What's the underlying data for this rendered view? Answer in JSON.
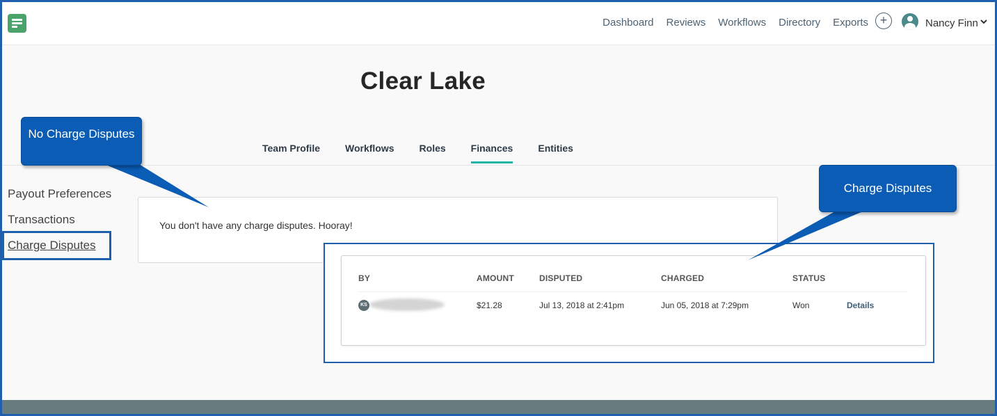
{
  "nav": {
    "links": [
      "Dashboard",
      "Reviews",
      "Workflows",
      "Directory",
      "Exports"
    ],
    "plus_symbol": "+",
    "user_name": "Nancy Finn"
  },
  "page": {
    "title": "Clear Lake",
    "tabs": [
      "Team Profile",
      "Workflows",
      "Roles",
      "Finances",
      "Entities"
    ],
    "active_tab": "Finances"
  },
  "sidebar": {
    "items": [
      "Payout Preferences",
      "Transactions",
      "Charge Disputes"
    ]
  },
  "empty_state": {
    "message": "You don't have any charge disputes. Hooray!"
  },
  "disputes": {
    "headers": [
      "BY",
      "AMOUNT",
      "DISPUTED",
      "CHARGED",
      "STATUS"
    ],
    "rows": [
      {
        "initials": "KS",
        "amount": "$21.28",
        "disputed": "Jul 13, 2018 at 2:41pm",
        "charged": "Jun 05, 2018 at 7:29pm",
        "status": "Won",
        "action": "Details"
      }
    ]
  },
  "callouts": {
    "no_disputes": "No Charge Disputes",
    "disputes": "Charge Disputes"
  },
  "colors": {
    "accent_tab": "#21b5a6",
    "callout": "#0b5cb5",
    "annotation_border": "#1f5fae",
    "logo": "#4aa36a",
    "footer": "#677c7e"
  },
  "icons": {
    "logo": "app-logo-icon",
    "plus": "plus-circle-icon",
    "avatar": "user-avatar-icon",
    "dropdown": "chevron-down-icon"
  }
}
